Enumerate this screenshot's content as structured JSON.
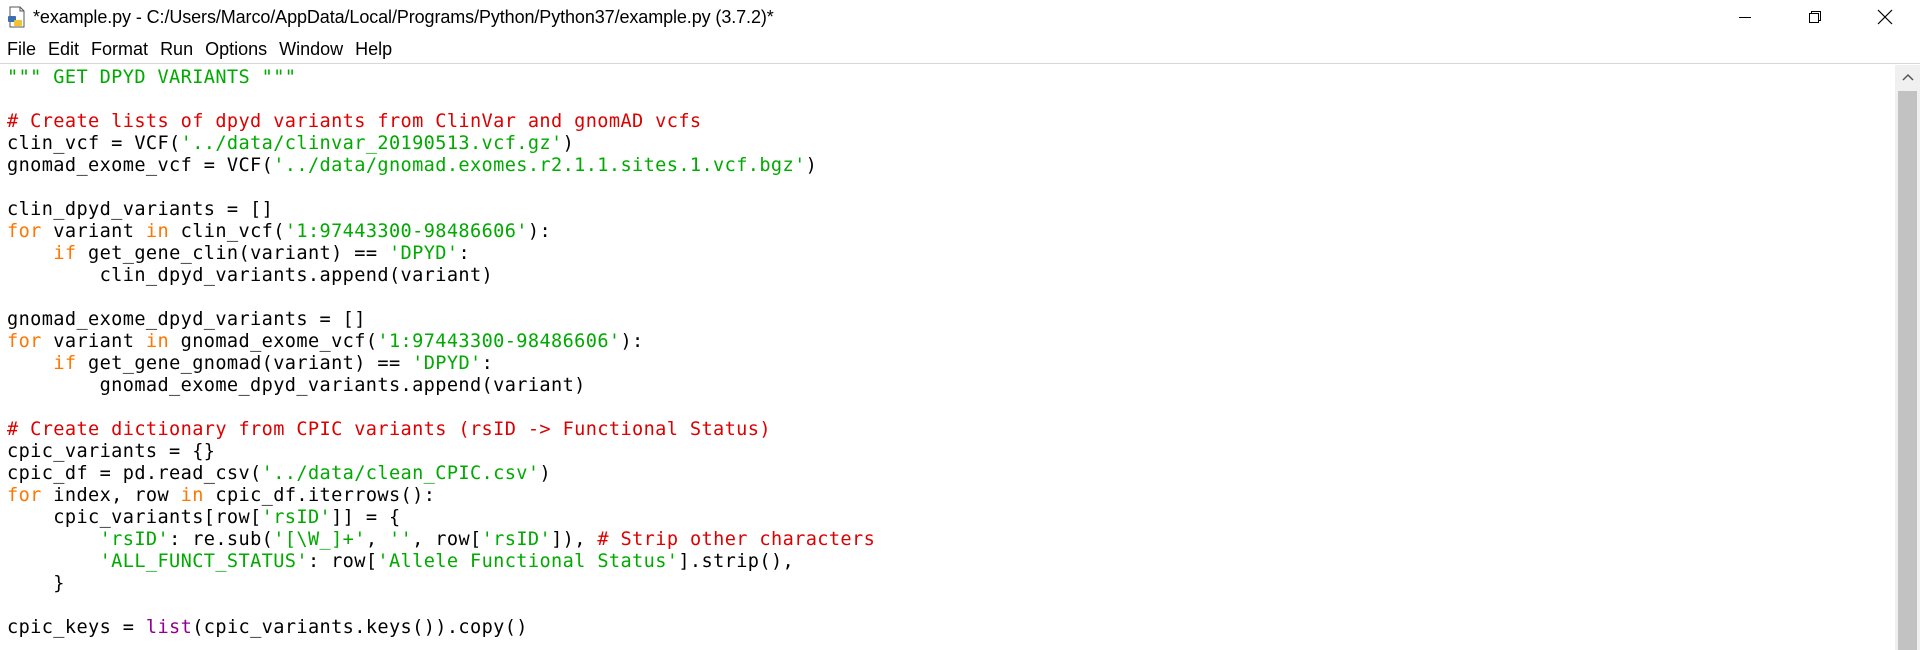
{
  "window": {
    "title": "*example.py - C:/Users/Marco/AppData/Local/Programs/Python/Python37/example.py (3.7.2)*",
    "icons": {
      "app": "python-file-icon",
      "minimize": "minimize-icon",
      "restore": "restore-icon",
      "close": "close-icon"
    }
  },
  "menubar": {
    "items": [
      "File",
      "Edit",
      "Format",
      "Run",
      "Options",
      "Window",
      "Help"
    ]
  },
  "editor": {
    "colors": {
      "string": "#00aa00",
      "comment": "#dd0000",
      "keyword": "#ff7700",
      "builtin": "#900090",
      "default": "#000000"
    },
    "lines": [
      [
        [
          "s",
          "\"\"\" GET DPYD VARIANTS \"\"\""
        ]
      ],
      [],
      [
        [
          "c",
          "# Create lists of dpyd variants from ClinVar and gnomAD vcfs"
        ]
      ],
      [
        [
          "n",
          "clin_vcf = VCF("
        ],
        [
          "s",
          "'../data/clinvar_20190513.vcf.gz'"
        ],
        [
          "n",
          ")"
        ]
      ],
      [
        [
          "n",
          "gnomad_exome_vcf = VCF("
        ],
        [
          "s",
          "'../data/gnomad.exomes.r2.1.1.sites.1.vcf.bgz'"
        ],
        [
          "n",
          ")"
        ]
      ],
      [],
      [
        [
          "n",
          "clin_dpyd_variants = []"
        ]
      ],
      [
        [
          "k",
          "for"
        ],
        [
          "n",
          " variant "
        ],
        [
          "k",
          "in"
        ],
        [
          "n",
          " clin_vcf("
        ],
        [
          "s",
          "'1:97443300-98486606'"
        ],
        [
          "n",
          "):"
        ]
      ],
      [
        [
          "n",
          "    "
        ],
        [
          "k",
          "if"
        ],
        [
          "n",
          " get_gene_clin(variant) == "
        ],
        [
          "s",
          "'DPYD'"
        ],
        [
          "n",
          ":"
        ]
      ],
      [
        [
          "n",
          "        clin_dpyd_variants.append(variant)"
        ]
      ],
      [],
      [
        [
          "n",
          "gnomad_exome_dpyd_variants = []"
        ]
      ],
      [
        [
          "k",
          "for"
        ],
        [
          "n",
          " variant "
        ],
        [
          "k",
          "in"
        ],
        [
          "n",
          " gnomad_exome_vcf("
        ],
        [
          "s",
          "'1:97443300-98486606'"
        ],
        [
          "n",
          "):"
        ]
      ],
      [
        [
          "n",
          "    "
        ],
        [
          "k",
          "if"
        ],
        [
          "n",
          " get_gene_gnomad(variant) == "
        ],
        [
          "s",
          "'DPYD'"
        ],
        [
          "n",
          ":"
        ]
      ],
      [
        [
          "n",
          "        gnomad_exome_dpyd_variants.append(variant)"
        ]
      ],
      [],
      [
        [
          "c",
          "# Create dictionary from CPIC variants (rsID -> Functional Status)"
        ]
      ],
      [
        [
          "n",
          "cpic_variants = {}"
        ]
      ],
      [
        [
          "n",
          "cpic_df = pd.read_csv("
        ],
        [
          "s",
          "'../data/clean_CPIC.csv'"
        ],
        [
          "n",
          ")"
        ]
      ],
      [
        [
          "k",
          "for"
        ],
        [
          "n",
          " index, row "
        ],
        [
          "k",
          "in"
        ],
        [
          "n",
          " cpic_df.iterrows():"
        ]
      ],
      [
        [
          "n",
          "    cpic_variants[row["
        ],
        [
          "s",
          "'rsID'"
        ],
        [
          "n",
          "]] = {"
        ]
      ],
      [
        [
          "n",
          "        "
        ],
        [
          "s",
          "'rsID'"
        ],
        [
          "n",
          ": re.sub("
        ],
        [
          "s",
          "'[\\W_]+'"
        ],
        [
          "n",
          ", "
        ],
        [
          "s",
          "''"
        ],
        [
          "n",
          ", row["
        ],
        [
          "s",
          "'rsID'"
        ],
        [
          "n",
          "]), "
        ],
        [
          "c",
          "# Strip other characters"
        ]
      ],
      [
        [
          "n",
          "        "
        ],
        [
          "s",
          "'ALL_FUNCT_STATUS'"
        ],
        [
          "n",
          ": row["
        ],
        [
          "s",
          "'Allele Functional Status'"
        ],
        [
          "n",
          "].strip(),"
        ]
      ],
      [
        [
          "n",
          "    }"
        ]
      ],
      [],
      [
        [
          "n",
          "cpic_keys = "
        ],
        [
          "b",
          "list"
        ],
        [
          "n",
          "(cpic_variants.keys()).copy()"
        ]
      ]
    ]
  },
  "scrollbar": {
    "up_icon": "scroll-up-arrow-icon"
  }
}
